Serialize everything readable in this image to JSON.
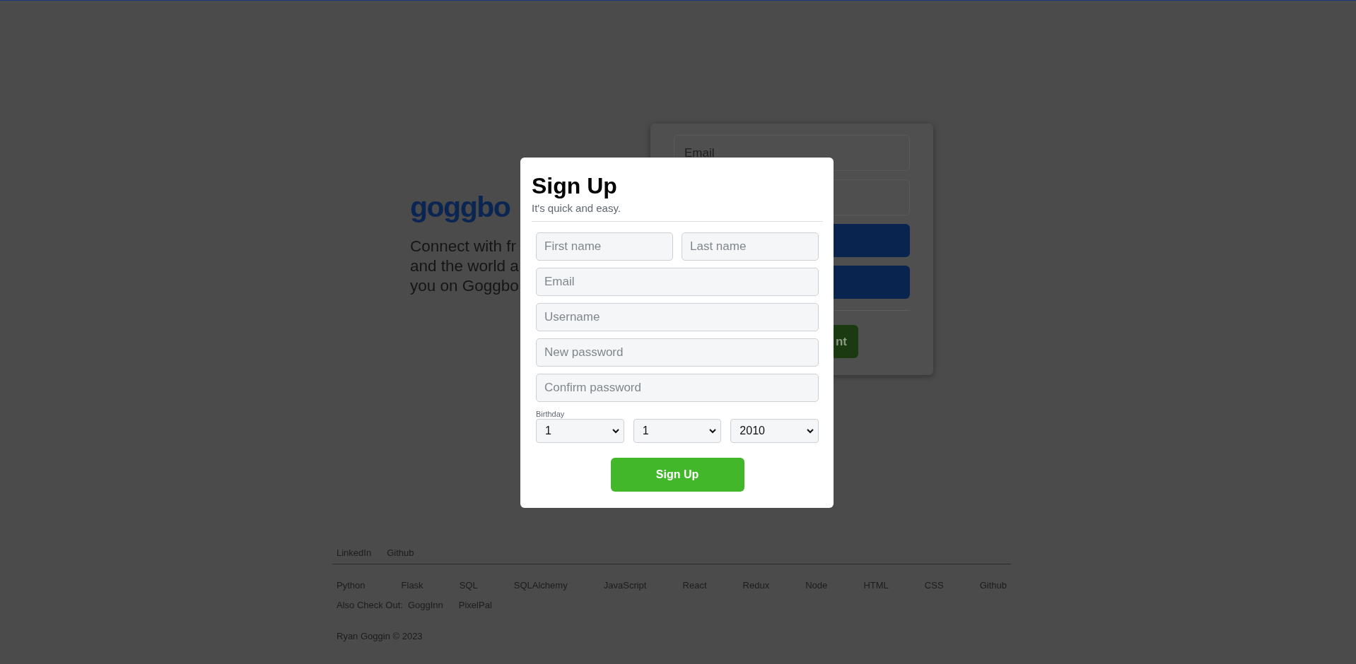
{
  "background_page": {
    "logo": "goggbo",
    "tagline": [
      "Connect with fr",
      "and the world a",
      "you on Goggbo"
    ],
    "login_card": {
      "email_placeholder": "Email",
      "button_text": "nt"
    }
  },
  "modal": {
    "title": "Sign Up",
    "subtitle": "It's quick and easy.",
    "name_fields": [
      {
        "placeholder": "First name"
      },
      {
        "placeholder": "Last name"
      }
    ],
    "fields": [
      {
        "placeholder": "Email"
      },
      {
        "placeholder": "Username"
      },
      {
        "placeholder": "New password"
      },
      {
        "placeholder": "Confirm password"
      }
    ],
    "birthday": {
      "label": "Birthday",
      "selects": [
        {
          "value": "1"
        },
        {
          "value": "1"
        },
        {
          "value": "2010"
        }
      ]
    },
    "submit": "Sign Up"
  },
  "footer": {
    "top_links": [
      "LinkedIn",
      "Github"
    ],
    "tech_links": [
      "Python",
      "Flask",
      "SQL",
      "SQLAlchemy",
      "JavaScript",
      "React",
      "Redux",
      "Node",
      "HTML",
      "CSS",
      "Github"
    ],
    "also_label": "Also Check Out:",
    "also_links": [
      "GoggInn",
      "PixelPal"
    ],
    "copyright": "Ryan Goggin © 2023"
  }
}
